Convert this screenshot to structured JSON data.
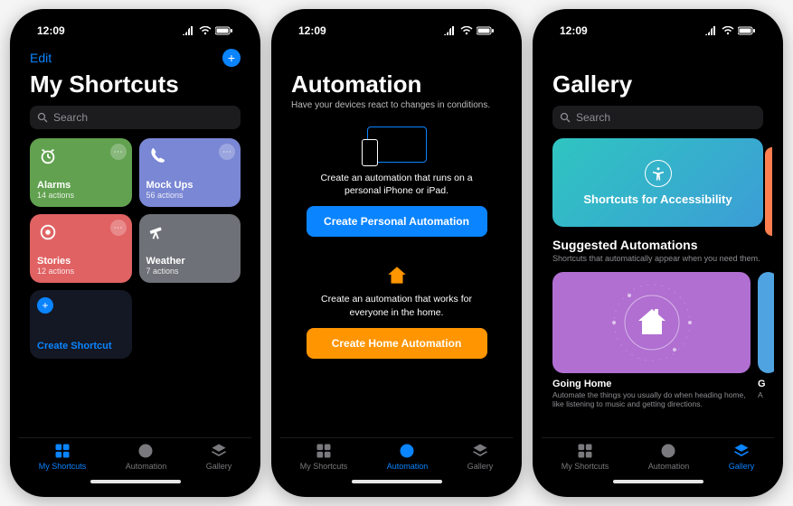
{
  "status": {
    "time": "12:09"
  },
  "phone1": {
    "edit": "Edit",
    "title": "My Shortcuts",
    "search_placeholder": "Search",
    "tiles": [
      {
        "name": "Alarms",
        "sub": "14 actions",
        "bg": "#61a14f",
        "icon": "alarm"
      },
      {
        "name": "Mock Ups",
        "sub": "56 actions",
        "bg": "#7a87d4",
        "icon": "phone"
      },
      {
        "name": "Stories",
        "sub": "12 actions",
        "bg": "#e06263",
        "icon": "circle"
      },
      {
        "name": "Weather",
        "sub": "7 actions",
        "bg": "#6e7177",
        "icon": "telescope"
      }
    ],
    "create": "Create Shortcut"
  },
  "phone2": {
    "title": "Automation",
    "subtitle": "Have your devices react to changes in conditions.",
    "personal_desc": "Create an automation that runs on a personal iPhone or iPad.",
    "personal_btn": "Create Personal Automation",
    "home_desc": "Create an automation that works for everyone in the home.",
    "home_btn": "Create Home Automation"
  },
  "phone3": {
    "title": "Gallery",
    "search_placeholder": "Search",
    "banner": "Shortcuts for Accessibility",
    "section_title": "Suggested Automations",
    "section_sub": "Shortcuts that automatically appear when you need them.",
    "card_title": "Going Home",
    "card_desc": "Automate the things you usually do when heading home, like listening to music and getting directions.",
    "peek_title": "G",
    "peek_desc": "A"
  },
  "tabs": [
    {
      "label": "My Shortcuts",
      "icon": "grid"
    },
    {
      "label": "Automation",
      "icon": "clock"
    },
    {
      "label": "Gallery",
      "icon": "stack"
    }
  ]
}
